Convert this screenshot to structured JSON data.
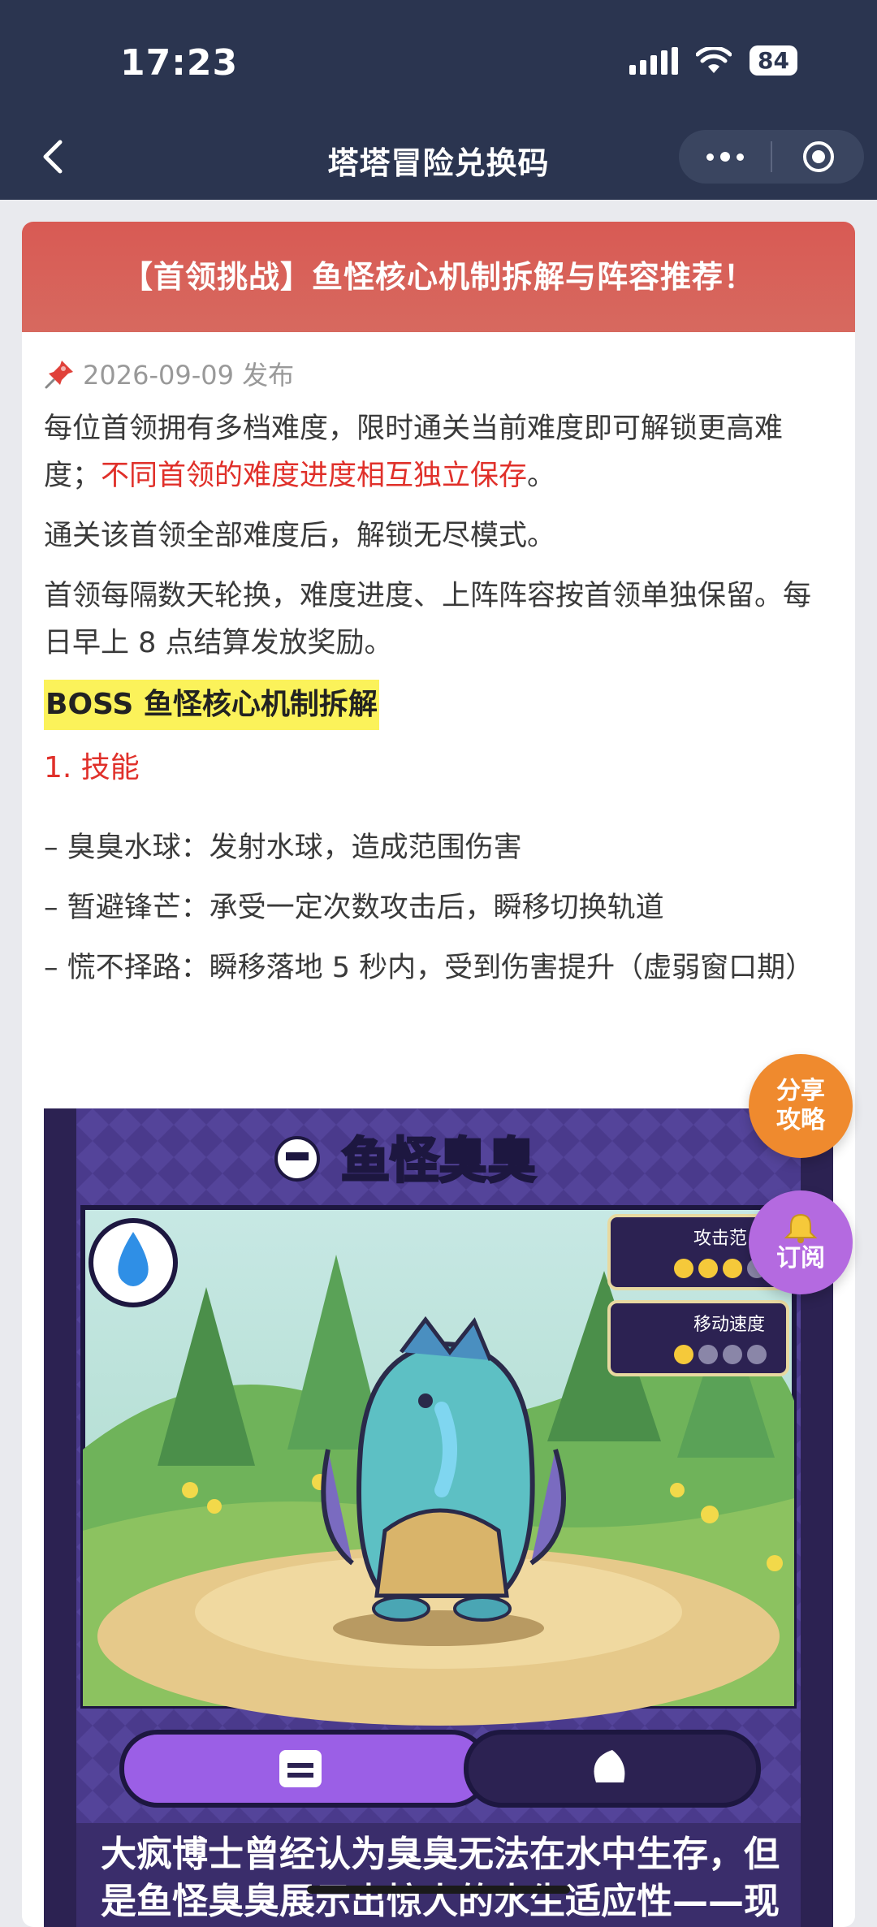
{
  "status_bar": {
    "time": "17:23",
    "battery": "84"
  },
  "nav": {
    "title": "塔塔冒险兑换码"
  },
  "article": {
    "title": "【首领挑战】鱼怪核心机制拆解与阵容推荐！",
    "meta": "2026-09-09 发布",
    "p1_text": "每位首领拥有多档难度，限时通关当前难度即可解锁更高难度；",
    "p1_highlight": "不同首领的难度进度相互独立保存",
    "p1_end": "。",
    "p2": "通关该首领全部难度后，解锁无尽模式。",
    "p3": "首领每隔数天轮换，难度进度、上阵阵容按首领单独保留。每日早上 8 点结算发放奖励。",
    "boss_heading": "BOSS 鱼怪核心机制拆解",
    "skills_heading": "1. 技能",
    "skills": [
      "– 臭臭水球：发射水球，造成范围伤害",
      "– 暂避锋芒：承受一定次数攻击后，瞬移切换轨道",
      "– 慌不择路：瞬移落地 5 秒内，受到伤害提升（虚弱窗口期）"
    ]
  },
  "game_card": {
    "name": "鱼怪臭臭",
    "stat1_label": "攻击范",
    "stat2_label": "移动速度",
    "stat1_stars": 3,
    "stat2_stars": 1,
    "description": "大疯博士曾经认为臭臭无法在水中生存，但是鱼怪臭臭展示出惊人的水生适应性——现在水里也不安全了！"
  },
  "fabs": {
    "share_line1": "分享",
    "share_line2": "攻略",
    "subscribe": "订阅"
  },
  "colors": {
    "nav_bg": "#2b3550",
    "header_red": "#d85a54",
    "highlight_yellow": "#fbf25a",
    "accent_red": "#e0302a",
    "share_orange": "#ef8a2e",
    "subscribe_purple": "#b46ae0"
  }
}
